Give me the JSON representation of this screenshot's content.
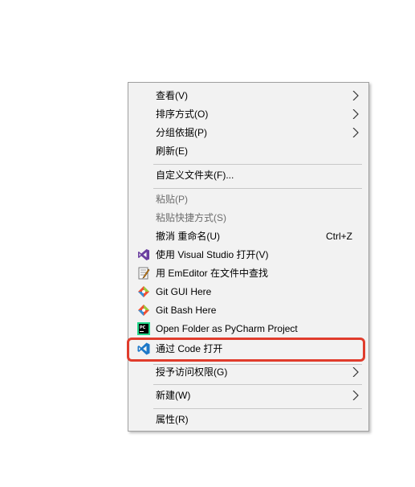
{
  "menu": {
    "view": "查看(V)",
    "sort": "排序方式(O)",
    "group": "分组依据(P)",
    "refresh": "刷新(E)",
    "customize": "自定义文件夹(F)...",
    "paste": "粘贴(P)",
    "paste_shortcut": "粘贴快捷方式(S)",
    "undo_rename": "撤消 重命名(U)",
    "undo_shortcut": "Ctrl+Z",
    "open_vs": "使用 Visual Studio 打开(V)",
    "emeditor": "用 EmEditor 在文件中查找",
    "git_gui": "Git GUI Here",
    "git_bash": "Git Bash Here",
    "pycharm": "Open Folder as PyCharm Project",
    "vscode": "通过 Code 打开",
    "give_access": "授予访问权限(G)",
    "new": "新建(W)",
    "properties": "属性(R)"
  },
  "colors": {
    "highlight_border": "#e03c2c",
    "vs_purple": "#6b3fa0",
    "vscode_blue": "#1e78c8"
  },
  "icons": {
    "vs": "visual-studio-icon",
    "emeditor": "emeditor-icon",
    "git": "git-icon",
    "pycharm": "pycharm-icon",
    "vscode": "vscode-icon",
    "arrow": "chevron-right-icon"
  }
}
